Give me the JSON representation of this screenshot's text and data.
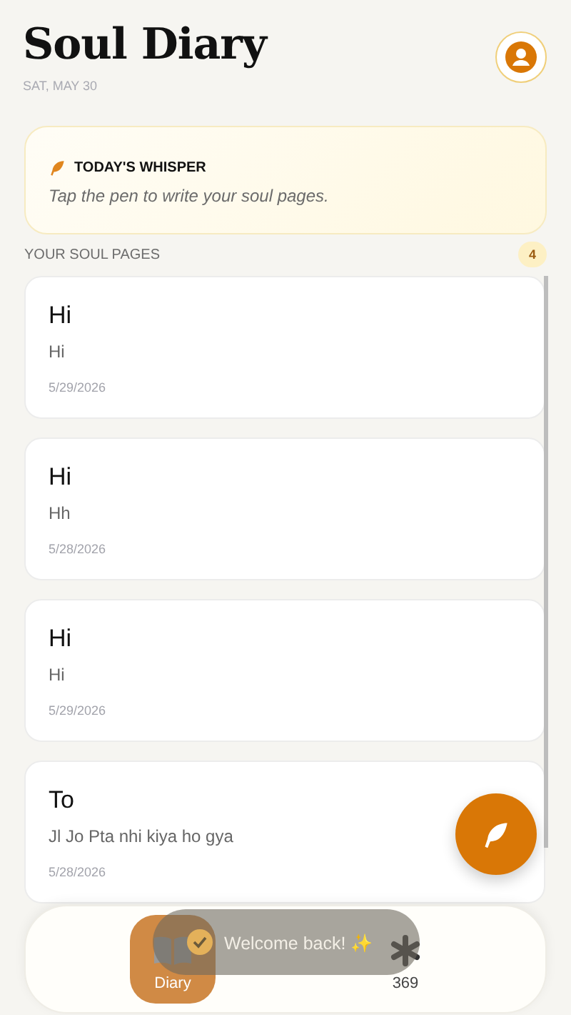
{
  "header": {
    "title": "Soul Diary",
    "date": "SAT, MAY 30"
  },
  "whisper": {
    "title": "TODAY'S WHISPER",
    "text": "Tap the pen to write your soul pages."
  },
  "section": {
    "title": "YOUR SOUL PAGES",
    "count": "4"
  },
  "entries": [
    {
      "title": "Hi",
      "body": "Hi",
      "date": "5/29/2026"
    },
    {
      "title": "Hi",
      "body": "Hh",
      "date": "5/28/2026"
    },
    {
      "title": "Hi",
      "body": "Hi",
      "date": "5/29/2026"
    },
    {
      "title": "To",
      "body": "Jl Jo Pta nhi kiya ho gya",
      "date": "5/28/2026"
    }
  ],
  "nav": [
    {
      "kind": "book",
      "label": "Diary",
      "selected": true
    },
    {
      "kind": "asterisk",
      "label": "369",
      "selected": false
    }
  ],
  "toast": {
    "text": "Welcome back! ✨"
  }
}
